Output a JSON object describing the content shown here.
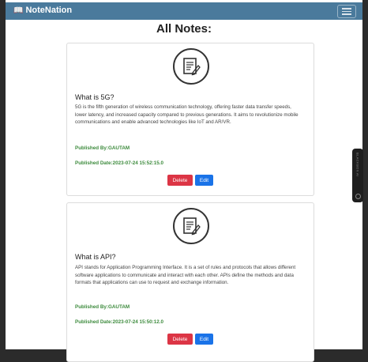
{
  "navbar": {
    "brand": "NoteNation",
    "brand_icon": "book-icon"
  },
  "page": {
    "title": "All Notes:"
  },
  "notes": [
    {
      "title": "What is 5G?",
      "body": "5G is the fifth generation of wireless communication technology, offering faster data transfer speeds, lower latency, and increased capacity compared to previous generations. It aims to revolutionize mobile communications and enable advanced technologies like IoT and AR/VR.",
      "published_by": "Published By:GAUTAM",
      "published_date": "Published Date:2023-07-24 15:52:15.0",
      "delete_label": "Delete",
      "edit_label": "Edit"
    },
    {
      "title": "What is API?",
      "body": "API stands for Application Programming Interface. It is a set of rules and protocols that allows different software applications to communicate and interact with each other. APIs define the methods and data formats that applications can use to request and exchange information.",
      "published_by": "Published By:GAUTAM",
      "published_date": "Published Date:2023-07-24 15:50:12.0",
      "delete_label": "Delete",
      "edit_label": "Edit"
    }
  ],
  "side_widget": {
    "label": "BLACKBOX AI"
  },
  "colors": {
    "navbar": "#4a7a9c",
    "delete": "#dc3545",
    "edit": "#1a73e8",
    "meta": "#3d8b3d"
  }
}
